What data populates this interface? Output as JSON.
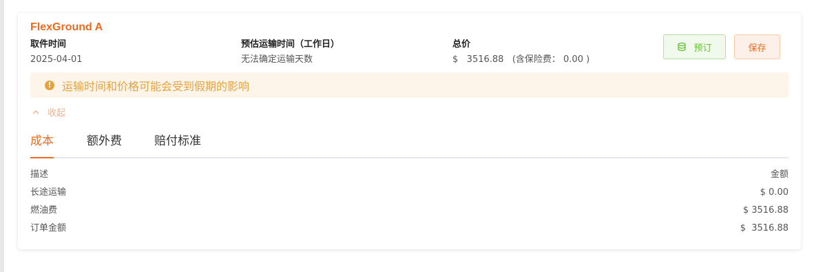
{
  "quote": {
    "carrier_name": "FlexGround A",
    "pickup_time_label": "取件时间",
    "pickup_time_value": "2025-04-01",
    "transit_time_label": "预估运输时间（工作日）",
    "transit_time_value": "无法确定运输天数",
    "total_label": "总价",
    "total_value": "$   3516.88   (含保险费： 0.00 )"
  },
  "actions": {
    "book_label": "预订",
    "book_icon": "coins-icon",
    "save_label": "保存"
  },
  "notice": {
    "text": "运输时间和价格可能会受到假期的影响",
    "icon": "exclamation-circle-icon",
    "color": "#e6a23c"
  },
  "collapse": {
    "label": "收起",
    "icon": "chevron-up-icon"
  },
  "tabs": [
    {
      "label": "成本",
      "active": true
    },
    {
      "label": "额外费",
      "active": false
    },
    {
      "label": "赔付标准",
      "active": false
    }
  ],
  "cost_table": {
    "header_description": "描述",
    "header_amount": "金额",
    "rows": [
      {
        "description": "长途运输",
        "amount": "$ 0.00"
      },
      {
        "description": "燃油费",
        "amount": "$ 3516.88"
      },
      {
        "description": "订单金额",
        "amount": "$  3516.88"
      }
    ]
  },
  "colors": {
    "accent": "#f06a1d",
    "success": "#67c23a",
    "warning": "#e6a23c"
  }
}
